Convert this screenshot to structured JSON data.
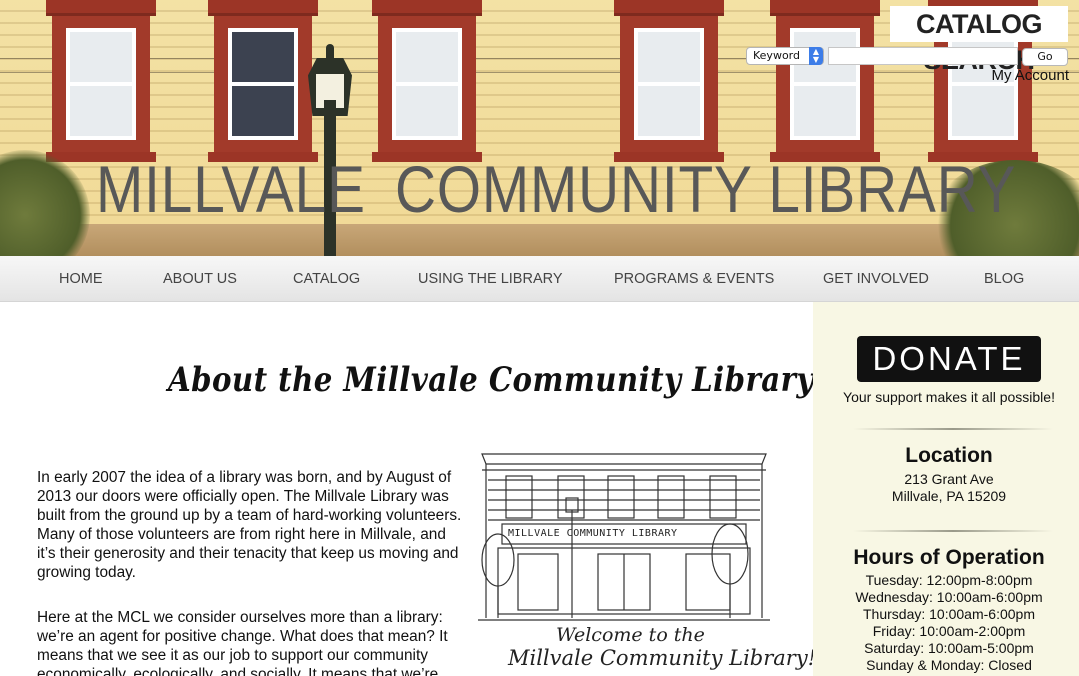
{
  "banner": {
    "title_left": "MILLVALE",
    "title_right": "COMMUNITY LIBRARY"
  },
  "catalog_search": {
    "title": "CATALOG SEARCH",
    "select_value": "Keyword",
    "input_value": "",
    "go_label": "Go",
    "my_account_label": "My Account"
  },
  "nav": {
    "items": [
      {
        "label": "HOME"
      },
      {
        "label": "ABOUT US"
      },
      {
        "label": "CATALOG"
      },
      {
        "label": "USING THE LIBRARY"
      },
      {
        "label": "PROGRAMS & EVENTS"
      },
      {
        "label": "GET INVOLVED"
      },
      {
        "label": "BLOG"
      }
    ]
  },
  "main": {
    "heading": "About the Millvale Community Library",
    "paragraph1": "In early 2007 the idea of a library was born, and by August of 2013 our doors were officially open. The Millvale Library was built from the ground up by a team of hard-working volunteers. Many of those volunteers are from right here in Millvale, and it’s their generosity and their tenacity that keep us moving and growing today.",
    "paragraph2": "Here at the MCL we consider ourselves more than a library: we’re an agent for positive change. What does that mean? It means that we see it as our job to support our community economically, ecologically, and socially. It means that we’re",
    "illustration": {
      "sign_text": "MILLVALE COMMUNITY LIBRARY",
      "caption_line1": "Welcome to the",
      "caption_line2": "Millvale Community Library!"
    }
  },
  "sidebar": {
    "donate_label": "DONATE",
    "donate_tagline": "Your support makes it all possible!",
    "location_heading": "Location",
    "address_line1": "213 Grant Ave",
    "address_line2": "Millvale, PA 15209",
    "hours_heading": "Hours of Operation",
    "hours": [
      "Tuesday: 12:00pm-8:00pm",
      "Wednesday: 10:00am-6:00pm",
      "Thursday: 10:00am-6:00pm",
      "Friday: 10:00am-2:00pm",
      "Saturday: 10:00am-5:00pm",
      "Sunday & Monday: Closed"
    ]
  }
}
